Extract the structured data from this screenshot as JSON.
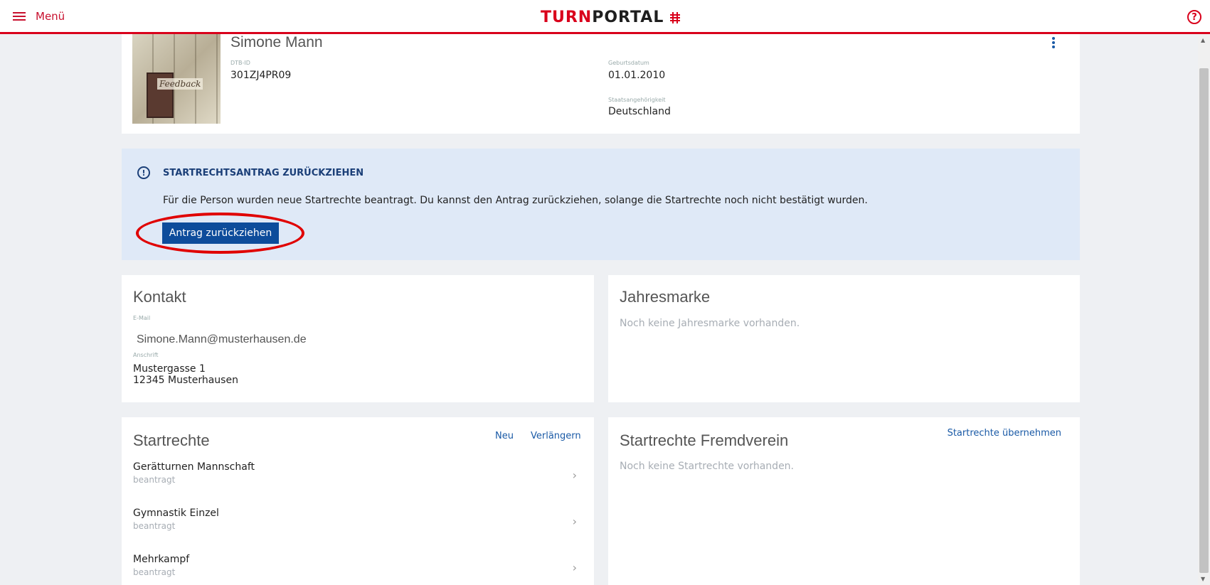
{
  "header": {
    "menu_label": "Menü",
    "logo_turn": "TURN",
    "logo_portal": "PORTAL",
    "help_symbol": "?"
  },
  "profile": {
    "name": "Simone Mann",
    "avatar_label": "Feedback",
    "dtb_id_label": "DTB-ID",
    "dtb_id": "301ZJ4PR09",
    "birth_label": "Geburtsdatum",
    "birth_date": "01.01.2010",
    "nationality_label": "Staatsangehörigkeit",
    "nationality": "Deutschland"
  },
  "notice": {
    "icon": "!",
    "title": "STARTRECHTSANTRAG ZURÜCKZIEHEN",
    "text": "Für die Person wurden neue Startrechte beantragt. Du kannst den Antrag zurückziehen, solange die Startrechte noch nicht bestätigt wurden.",
    "button_label": "Antrag zurückziehen"
  },
  "kontakt": {
    "title": "Kontakt",
    "email_label": "E-Mail",
    "email": "Simone.Mann@musterhausen.de",
    "address_label": "Anschrift",
    "street": "Mustergasse 1",
    "city": "12345 Musterhausen"
  },
  "jahresmarke": {
    "title": "Jahresmarke",
    "empty_text": "Noch keine Jahresmarke vorhanden."
  },
  "startrechte": {
    "title": "Startrechte",
    "new_label": "Neu",
    "extend_label": "Verlängern",
    "items": [
      {
        "title": "Gerätturnen Mannschaft",
        "status": "beantragt"
      },
      {
        "title": "Gymnastik Einzel",
        "status": "beantragt"
      },
      {
        "title": "Mehrkampf",
        "status": "beantragt"
      }
    ]
  },
  "fremdverein": {
    "title": "Startrechte Fremdverein",
    "take_over_label": "Startrechte übernehmen",
    "empty_text": "Noch keine Startrechte vorhanden."
  },
  "colors": {
    "brand_red": "#d9001b",
    "primary_blue": "#0d4c9b",
    "notice_bg": "#dfe9f7"
  }
}
